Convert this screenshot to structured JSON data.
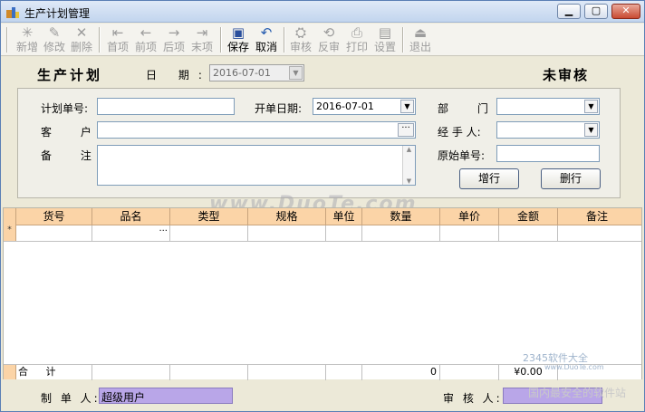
{
  "window": {
    "title": "生产计划管理"
  },
  "toolbar": {
    "add": "新增",
    "edit": "修改",
    "delete": "删除",
    "first": "首项",
    "prev": "前项",
    "next": "后项",
    "last": "末项",
    "save": "保存",
    "cancel": "取消",
    "audit": "审核",
    "unaudit": "反审",
    "print": "打印",
    "settings": "设置",
    "exit": "退出"
  },
  "header": {
    "title": "生产计划",
    "date_label": "日 期:",
    "date_value": "2016-07-01",
    "status": "未审核"
  },
  "form": {
    "plan_no_label": "计划单号:",
    "plan_no_value": "",
    "open_date_label": "开单日期:",
    "open_date_value": "2016-07-01",
    "dept_label": "部 门:",
    "customer_label": "客 户:",
    "handler_label": "经 手 人:",
    "remark_label": "备 注:",
    "orig_no_label": "原始单号:",
    "add_row": "增行",
    "delete_row": "删行"
  },
  "grid": {
    "columns": [
      "货号",
      "品名",
      "类型",
      "规格",
      "单位",
      "数量",
      "单价",
      "金额",
      "备注"
    ],
    "new_row_marker": "*",
    "cell_ellipsis": "···",
    "total_label": "合 计",
    "total_qty": "0",
    "total_amount": "¥0.00"
  },
  "footer": {
    "maker_label": "制 单 人:",
    "maker_value": "超级用户",
    "auditor_label": "审 核 人:",
    "auditor_value": ""
  },
  "watermarks": {
    "center": "www.DuoTe.com",
    "brand": "2345软件大全",
    "brand_url": "www.DuoTe.com",
    "brand_slogan": "国内最安全的软件站"
  }
}
